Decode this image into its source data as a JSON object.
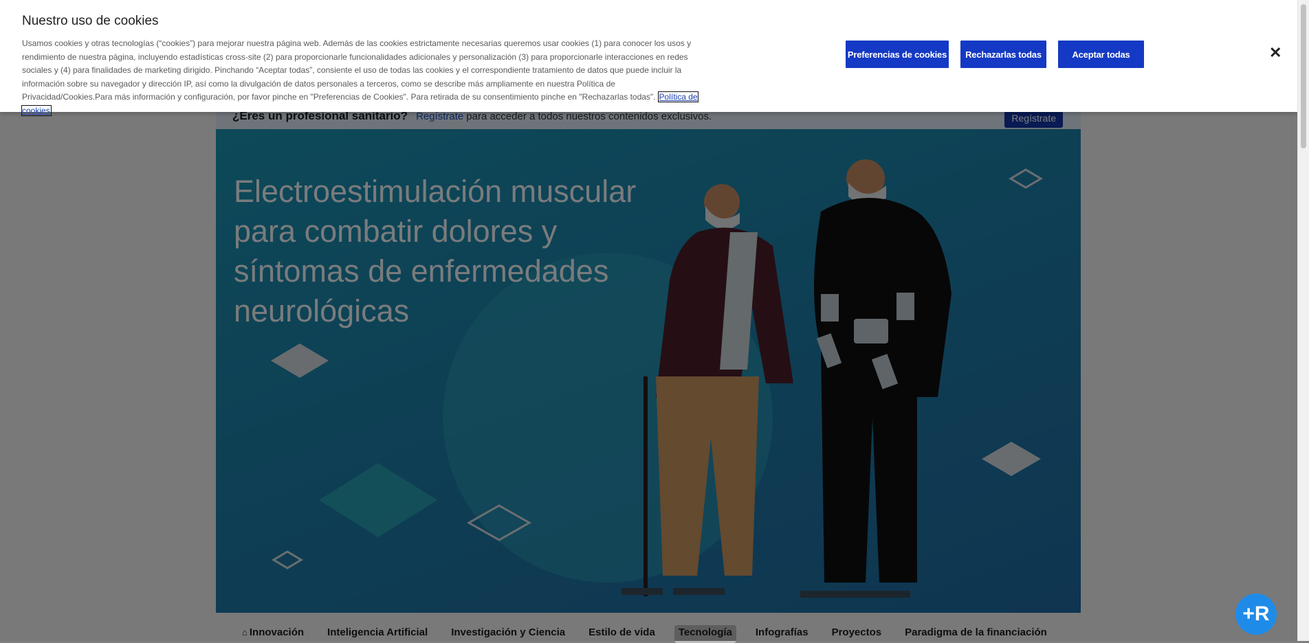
{
  "cookie_banner": {
    "title": "Nuestro uso de cookies",
    "text": "Usamos cookies y otras tecnologías (“cookies”) para mejorar nuestra página web. Además de las cookies estrictamente necesarias queremos usar cookies (1) para conocer los usos y rendimiento de nuestra página, incluyendo estadísticas cross-site (2) para proporcionarle funcionalidades adicionales y personalización (3) para proporcionarle interacciones en redes sociales y (4) para finalidades de marketing dirigido. Pinchando “Aceptar todas”, consiente el uso de todas las cookies y el correspondiente tratamiento de datos que puede incluir la información sobre su navegador y dirección IP, así como la divulgación de datos personales a terceros, como se describe más ampliamente en nuestra Política de Privacidad/Cookies.Para más información y configuración, por favor pinche en \"Preferencias de Cookies\". Para retirada de su consentimiento pinche en \"Rechazarlas todas\".",
    "policy_link": "Política de cookies",
    "preferences_button": "Preferencias de cookies",
    "reject_button": "Rechazarlas todas",
    "accept_button": "Aceptar todas",
    "close_icon": "close-icon",
    "close_glyph": "✕"
  },
  "professional_bar": {
    "question": "¿Eres un profesional sanitario?",
    "link": "Regístrate",
    "text": "para acceder a todos nuestros contenidos exclusivos.",
    "button": "Regístrate"
  },
  "hero": {
    "title": "Electroestimulación muscular para combatir dolores y síntomas de enfermedades neurológicas"
  },
  "nav": {
    "home_icon": "home-icon",
    "home_glyph": "⌂",
    "tabs": [
      {
        "label": "Innovación"
      },
      {
        "label": "Inteligencia Artificial"
      },
      {
        "label": "Investigación y Ciencia"
      },
      {
        "label": "Estilo de vida"
      },
      {
        "label": "Tecnología",
        "active": true
      },
      {
        "label": "Infografías"
      },
      {
        "label": "Proyectos"
      },
      {
        "label": "Paradigma de la financiación"
      }
    ]
  },
  "help_widget": {
    "icon": "assistant-icon",
    "glyph": "+R"
  },
  "colors": {
    "accent": "#1439c4",
    "hero_bg": "#1d7fa8",
    "link": "#2450b8"
  }
}
